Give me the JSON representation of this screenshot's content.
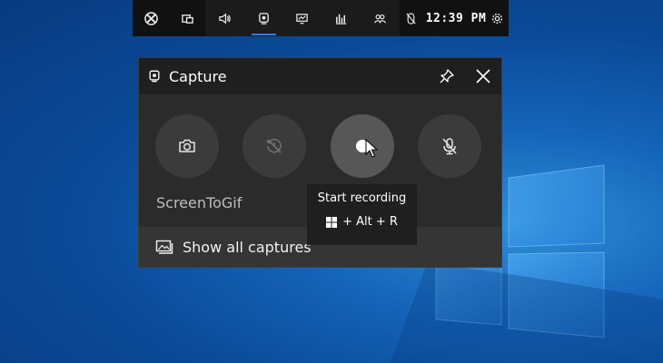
{
  "topbar": {
    "clock": "12:39 PM",
    "buttons": [
      "xbox-icon",
      "widget-menu-icon",
      "audio-icon",
      "capture-icon",
      "performance-icon",
      "resources-icon",
      "social-icon",
      "mouse-icon",
      "settings-icon"
    ],
    "active": "capture-icon"
  },
  "panel": {
    "title": "Capture",
    "app_name": "ScreenToGif",
    "footer_label": "Show all captures",
    "buttons": [
      "screenshot-button",
      "record-last-button",
      "start-recording-button",
      "microphone-button"
    ]
  },
  "tooltip": {
    "title": "Start recording",
    "shortcut": "+ Alt + R"
  },
  "colors": {
    "accent": "#2d7ff9",
    "panel_bg": "#2b2b2b",
    "header_bg": "#1f1f1f",
    "circle_bg": "#3b3b3b"
  }
}
